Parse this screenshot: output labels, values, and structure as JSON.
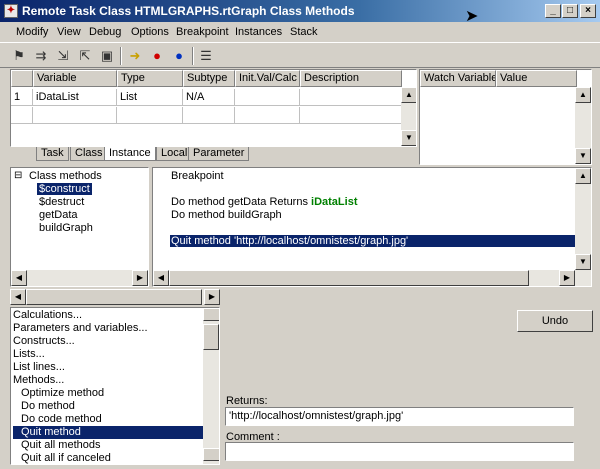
{
  "window": {
    "title": "Remote Task Class HTMLGRAPHS.rtGraph Class Methods",
    "controls": [
      "_",
      "□",
      "×"
    ]
  },
  "menu": [
    "Modify",
    "View",
    "Debug",
    "Options",
    "Breakpoint",
    "Instances",
    "Stack"
  ],
  "toolbar": {
    "icons": [
      "run-icon",
      "step-icon",
      "step-into-icon",
      "step-out-icon",
      "monitor-icon",
      "go-icon",
      "breakpoint-red-icon",
      "breakpoint-blue-icon",
      "trace-icon"
    ]
  },
  "variables": {
    "columns": [
      "Variable",
      "Type",
      "Subtype",
      "Init.Val/Calc",
      "Description"
    ],
    "rows": [
      {
        "num": "1",
        "variable": "iDataList",
        "type": "List",
        "subtype": "N/A",
        "init": "",
        "description": ""
      }
    ],
    "tabs": [
      "Task",
      "Class",
      "Instance",
      "Local",
      "Parameter"
    ],
    "active_tab": "Instance"
  },
  "watch": {
    "columns": [
      "Watch Variable",
      "Value"
    ]
  },
  "tree": {
    "root": "Class methods",
    "items": [
      "$construct",
      "$destruct",
      "getData",
      "buildGraph"
    ],
    "selected": "$construct"
  },
  "code": {
    "lines": [
      {
        "text": "Breakpoint"
      },
      {
        "text": "Do method getData Returns ",
        "highlight": "iDataList"
      },
      {
        "text": "Do method buildGraph"
      },
      {
        "text": "Quit method 'http://localhost/omnistest/graph.jpg'"
      }
    ],
    "selected_line": 3
  },
  "commands": {
    "items": [
      "Calculations...",
      "Parameters and variables...",
      "Constructs...",
      "Lists...",
      "List lines...",
      "Methods...",
      "Optimize method",
      "Do method",
      "Do code method",
      "Quit method",
      "Quit all methods",
      "Quit all if canceled"
    ],
    "indented_from": 6,
    "selected": "Quit method"
  },
  "detail": {
    "undo_label": "Undo",
    "returns_label": "Returns:",
    "returns_value": "'http://localhost/omnistest/graph.jpg'",
    "comment_label": "Comment :",
    "comment_value": ""
  },
  "colors": {
    "title_start": "#0a246a",
    "selection": "#0a246a",
    "highlight_text": "#008000"
  }
}
